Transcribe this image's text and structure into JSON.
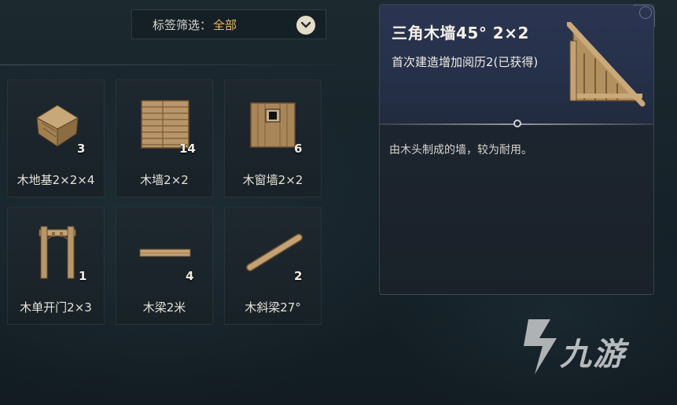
{
  "filter": {
    "label": "标签筛选：",
    "value": "全部",
    "dropdown_icon": "chevron-down-icon"
  },
  "items": [
    {
      "name": "木地基2×2×4",
      "count": "3",
      "icon": "wood-foundation-icon"
    },
    {
      "name": "木墙2×2",
      "count": "14",
      "icon": "wood-wall-icon"
    },
    {
      "name": "木窗墙2×2",
      "count": "6",
      "icon": "wood-window-wall-icon"
    },
    {
      "name": "木单开门2×3",
      "count": "1",
      "icon": "wood-door-frame-icon"
    },
    {
      "name": "木梁2米",
      "count": "4",
      "icon": "wood-beam-icon"
    },
    {
      "name": "木斜梁27°",
      "count": "2",
      "icon": "wood-slanted-beam-icon"
    }
  ],
  "detail": {
    "title": "三角木墙45° 2×2",
    "subtitle": "首次建造增加阅历2(已获得)",
    "description": "由木头制成的墙，较为耐用。",
    "icon": "triangle-wood-wall-icon"
  },
  "watermark": {
    "text": "九游",
    "logo": "9game-logo-icon"
  },
  "colors": {
    "accent": "#e9b865",
    "panel_header": "#2b3552",
    "background": "#16232a"
  }
}
